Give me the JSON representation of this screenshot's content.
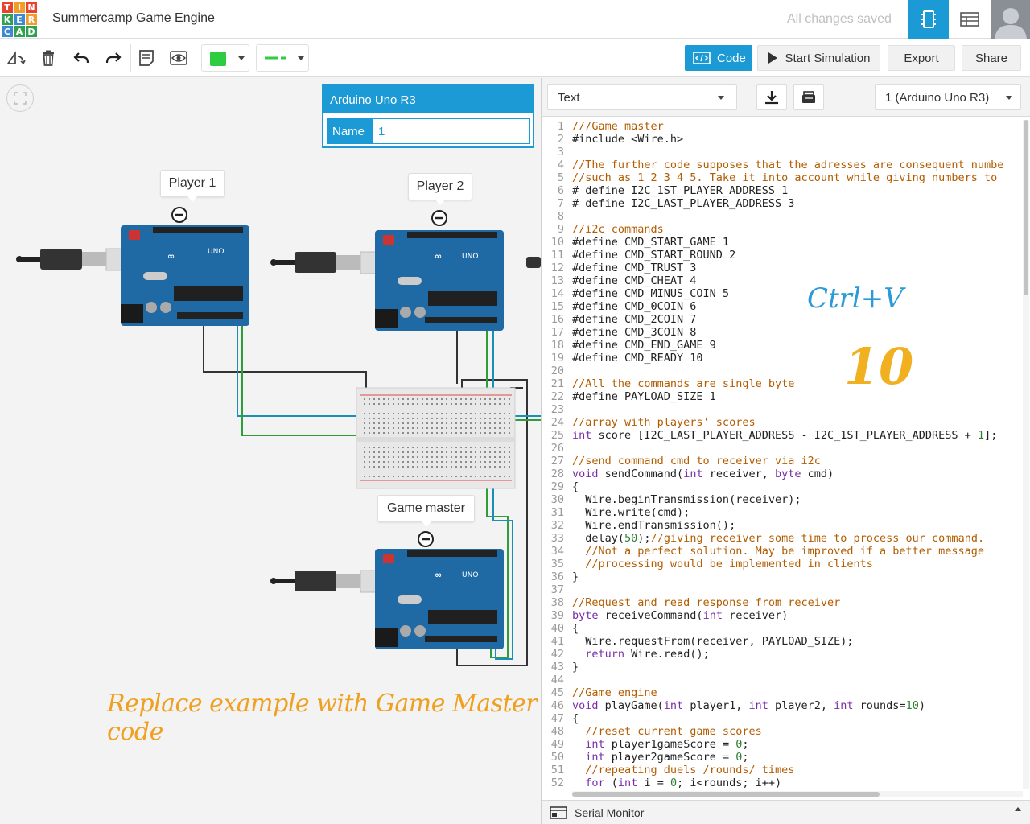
{
  "header": {
    "logo_letters": [
      "T",
      "I",
      "N",
      "K",
      "E",
      "R",
      "C",
      "A",
      "D"
    ],
    "logo_colors": [
      "#e8432d",
      "#f29d2a",
      "#e8432d",
      "#2ea24f",
      "#3d8ad1",
      "#f29d2a",
      "#3d8ad1",
      "#2ea24f",
      "#2ea24f"
    ],
    "project_title": "Summercamp Game Engine",
    "save_status": "All changes saved",
    "accent": "#1b9ad6"
  },
  "toolbar": {
    "color_value": "#2ecc40",
    "code_label": "Code",
    "start_simulation_label": "Start Simulation",
    "export_label": "Export",
    "share_label": "Share"
  },
  "inspector": {
    "title": "Arduino Uno R3",
    "name_label": "Name",
    "name_value": "1"
  },
  "callouts": {
    "player1": "Player 1",
    "player2": "Player 2",
    "gamemaster": "Game master"
  },
  "annotations": {
    "ctrl_v": "Ctrl+V",
    "ten": "10",
    "replace_note": "Replace example with Game Master code"
  },
  "code_panel": {
    "mode": "Text",
    "device": "1 (Arduino Uno R3)",
    "serial_monitor": "Serial Monitor",
    "lines": [
      [
        "cm",
        "///Game master"
      ],
      [
        "src",
        "#include <Wire.h>"
      ],
      [
        "src",
        ""
      ],
      [
        "cm",
        "//The further code supposes that the adresses are consequent numbe"
      ],
      [
        "cm",
        "//such as 1 2 3 4 5. Take it into account while giving numbers to"
      ],
      [
        "src",
        "# define I2C_1ST_PLAYER_ADDRESS 1"
      ],
      [
        "src",
        "# define I2C_LAST_PLAYER_ADDRESS 3"
      ],
      [
        "src",
        ""
      ],
      [
        "cm",
        "//i2c commands"
      ],
      [
        "src",
        "#define CMD_START_GAME 1"
      ],
      [
        "src",
        "#define CMD_START_ROUND 2"
      ],
      [
        "src",
        "#define CMD_TRUST 3"
      ],
      [
        "src",
        "#define CMD_CHEAT 4"
      ],
      [
        "src",
        "#define CMD_MINUS_COIN 5"
      ],
      [
        "src",
        "#define CMD_0COIN 6"
      ],
      [
        "src",
        "#define CMD_2COIN 7"
      ],
      [
        "src",
        "#define CMD_3COIN 8"
      ],
      [
        "src",
        "#define CMD_END_GAME 9"
      ],
      [
        "src",
        "#define CMD_READY 10"
      ],
      [
        "src",
        ""
      ],
      [
        "cm",
        "//All the commands are single byte"
      ],
      [
        "src",
        "#define PAYLOAD_SIZE 1"
      ],
      [
        "src",
        ""
      ],
      [
        "cm",
        "//array with players' scores"
      ],
      [
        "src",
        "int score [I2C_LAST_PLAYER_ADDRESS - I2C_1ST_PLAYER_ADDRESS + 1];"
      ],
      [
        "src",
        ""
      ],
      [
        "cm",
        "//send command cmd to receiver via i2c"
      ],
      [
        "src",
        "void sendCommand(int receiver, byte cmd)"
      ],
      [
        "src",
        "{"
      ],
      [
        "src",
        "  Wire.beginTransmission(receiver);"
      ],
      [
        "src",
        "  Wire.write(cmd);"
      ],
      [
        "src",
        "  Wire.endTransmission();"
      ],
      [
        "src",
        "  delay(50);//giving receiver some time to process our command."
      ],
      [
        "cm",
        "  //Not a perfect solution. May be improved if a better message"
      ],
      [
        "cm",
        "  //processing would be implemented in clients"
      ],
      [
        "src",
        "}"
      ],
      [
        "src",
        ""
      ],
      [
        "cm",
        "//Request and read response from receiver"
      ],
      [
        "src",
        "byte receiveCommand(int receiver)"
      ],
      [
        "src",
        "{"
      ],
      [
        "src",
        "  Wire.requestFrom(receiver, PAYLOAD_SIZE);"
      ],
      [
        "src",
        "  return Wire.read();"
      ],
      [
        "src",
        "}"
      ],
      [
        "src",
        ""
      ],
      [
        "cm",
        "//Game engine"
      ],
      [
        "src",
        "void playGame(int player1, int player2, int rounds=10)"
      ],
      [
        "src",
        "{"
      ],
      [
        "cm",
        "  //reset current game scores"
      ],
      [
        "src",
        "  int player1gameScore = 0;"
      ],
      [
        "src",
        "  int player2gameScore = 0;"
      ],
      [
        "cm",
        "  //repeating duels /rounds/ times"
      ],
      [
        "src",
        "  for (int i = 0; i<rounds; i++)"
      ],
      [
        "src",
        ""
      ]
    ]
  }
}
